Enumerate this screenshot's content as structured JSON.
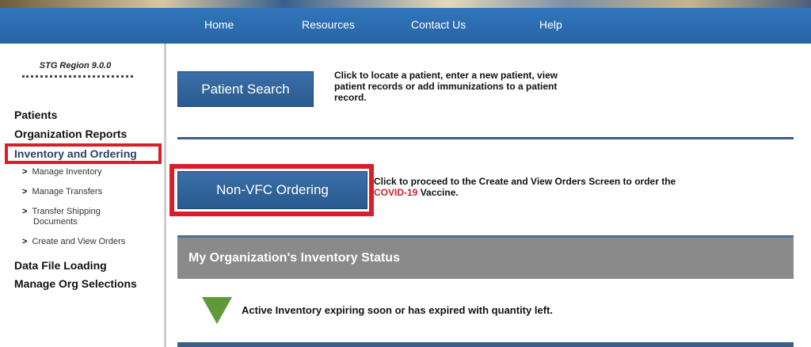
{
  "nav": {
    "items": [
      {
        "label": "Home"
      },
      {
        "label": "Resources"
      },
      {
        "label": "Contact Us"
      },
      {
        "label": "Help"
      }
    ]
  },
  "sidebar": {
    "version": "STG Region 9.0.0",
    "patients": "Patients",
    "org_reports": "Organization Reports",
    "inventory": "Inventory and Ordering",
    "sub_items": [
      {
        "label": "Manage Inventory"
      },
      {
        "label": "Manage Transfers"
      },
      {
        "label": "Transfer Shipping"
      },
      {
        "label": "Documents"
      },
      {
        "label": "Create and View Orders"
      }
    ],
    "data_file": "Data File Loading",
    "manage_org": "Manage Org Selections"
  },
  "main": {
    "patient_search": {
      "label": "Patient Search",
      "desc_lines": [
        "Click to locate a patient, enter a new patient, view",
        "patient records or add immunizations to a patient",
        "record."
      ]
    },
    "non_vfc": {
      "label": "Non-VFC Ordering",
      "desc_line1": "Click to proceed to the Create and View Orders Screen to order the",
      "desc_covid": "COVID-19",
      "desc_vaccine": " Vaccine."
    },
    "status": {
      "title": "My Organization's Inventory Status",
      "legend": "Active Inventory expiring soon or has expired with quantity left."
    }
  },
  "colors": {
    "nav_blue": "#2b6cb0",
    "button_blue": "#2c5f96",
    "highlight_red": "#d91e2a",
    "status_gray": "#8a8a8a",
    "legend_green": "#5e9a3a"
  }
}
